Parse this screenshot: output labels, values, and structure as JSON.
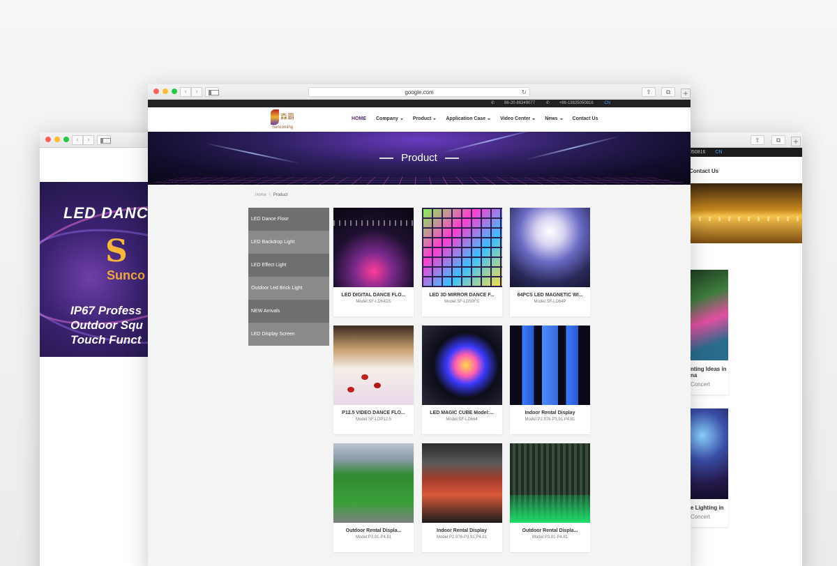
{
  "main_window": {
    "url": "google.com",
    "topbar": {
      "phone1": "86-20-86349077",
      "phone2": "+86-13825050816",
      "lang": "CN"
    },
    "logo": {
      "zh": "森霸",
      "en": "Suncoming"
    },
    "nav": [
      {
        "label": "HOME",
        "active": true,
        "dropdown": false
      },
      {
        "label": "Company",
        "dropdown": true
      },
      {
        "label": "Product",
        "dropdown": true
      },
      {
        "label": "Application Case",
        "dropdown": true
      },
      {
        "label": "Video Center",
        "dropdown": true
      },
      {
        "label": "News",
        "dropdown": true
      },
      {
        "label": "Contact Us",
        "dropdown": false
      }
    ],
    "hero_title": "Product",
    "breadcrumb": {
      "home": "Home",
      "separator": "\\",
      "current": "Product"
    },
    "categories": [
      "LED Dance Floor",
      "LED Backdrop Light",
      "LED Effect Light",
      "Outdoor Led Brick Light",
      "NEW Arrivals",
      "LED Display Screen"
    ],
    "products": [
      {
        "title": "LED DIGITAL DANCE FLO...",
        "model": "Model:SF-LD64DS"
      },
      {
        "title": "LED 3D MIRROR DANCE F...",
        "model": "Model:SF-LD50FS"
      },
      {
        "title": "64PCS LED MAGNETIC WI...",
        "model": "Model:SF-LD64P"
      },
      {
        "title": "P12.5 VIDEO DANCE FLO...",
        "model": "Model:SF-LDP12.5"
      },
      {
        "title": "LED MAGIC CUBE Model:...",
        "model": "Model:SF-LD664"
      },
      {
        "title": "Indoor Rental Display",
        "model": "Model:P2.976-P3.91,P4.81"
      },
      {
        "title": "Outdoor Rental Displa...",
        "model": "Model:P3.91-P4.81"
      },
      {
        "title": "Indoor Rental Display",
        "model": "Model:P2.976-P3.91,P4.81"
      },
      {
        "title": "Outdoor Rental Displa...",
        "model": "Model:P3.91-P4.81"
      }
    ]
  },
  "left_window": {
    "banner_title": "LED DANC",
    "logo_en": "Sunco",
    "lines": [
      "IP67 Profess",
      "Outdoor Squ",
      "Touch Funct"
    ]
  },
  "right_window": {
    "topbar_phone": "050816",
    "topbar_lang": "CN",
    "nav_item": "Contact Us",
    "cards": [
      {
        "title": "nting Ideas in\nna",
        "sub": "Concert"
      },
      {
        "title": "e Lighting in",
        "sub": "Concert"
      }
    ]
  },
  "colors": {
    "nav_active": "#5a2c7a",
    "category_dark": "#6f6f6f",
    "category_light": "#8a8a8a",
    "lang_link": "#4aa3ff"
  }
}
